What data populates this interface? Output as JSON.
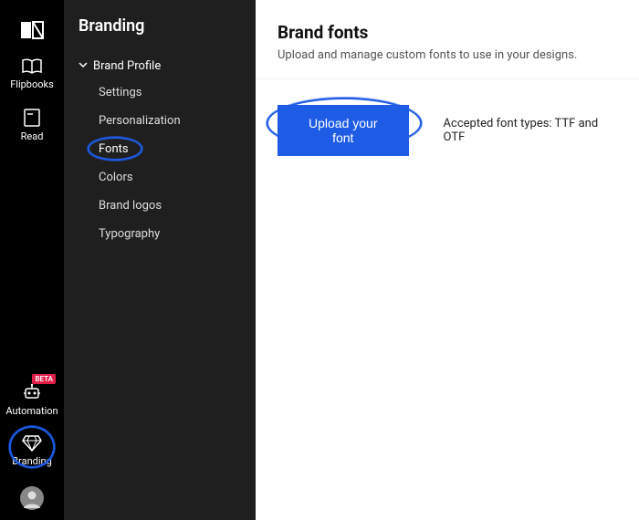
{
  "nav": {
    "items": [
      {
        "label": "Flipbooks"
      },
      {
        "label": "Read"
      }
    ],
    "automation": {
      "label": "Automation",
      "badge": "BETA"
    },
    "branding": {
      "label": "Branding"
    }
  },
  "panel": {
    "title": "Branding",
    "group": {
      "label": "Brand Profile"
    },
    "children": [
      {
        "label": "Settings"
      },
      {
        "label": "Personalization"
      },
      {
        "label": "Fonts"
      },
      {
        "label": "Colors"
      },
      {
        "label": "Brand logos"
      },
      {
        "label": "Typography"
      }
    ]
  },
  "main": {
    "title": "Brand fonts",
    "subtitle": "Upload and manage custom fonts to use in your designs.",
    "upload_label": "Upload your font",
    "accepted_text": "Accepted font types: TTF and OTF"
  },
  "colors": {
    "accent": "#1e5ce6",
    "beta_bg": "#e11d48"
  }
}
